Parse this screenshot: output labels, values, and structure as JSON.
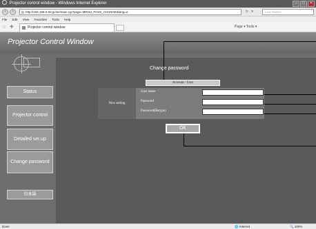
{
  "browser": {
    "window_title": "Projector control window - Windows Internet Explorer",
    "address": "http://192.168.0.8/cgi-bin/main.cgi?page=MENU_PASS_CHANGE&lang=e",
    "search_placeholder": "Live Search",
    "menu": [
      "File",
      "Edit",
      "View",
      "Favorites",
      "Tools",
      "Help"
    ],
    "tab_label": "Projector control window",
    "command_bar": "Page ▾  Tools ▾"
  },
  "app": {
    "title": "Projector Control Window",
    "sidebar": [
      {
        "label": "Status"
      },
      {
        "label": "Projector control"
      },
      {
        "label": "Detailed set up"
      },
      {
        "label": "Change password"
      },
      {
        "label": "日本語"
      }
    ]
  },
  "content": {
    "title": "Change password",
    "account": "Account : User",
    "new_setting_label": "New setting",
    "fields": [
      {
        "label": "User name",
        "value": ""
      },
      {
        "label": "Password",
        "value": ""
      },
      {
        "label": "Password(Retype)",
        "value": ""
      }
    ],
    "ok_label": "OK"
  },
  "status": {
    "left": "Done",
    "zone": "Internet",
    "zoom": "100%"
  }
}
